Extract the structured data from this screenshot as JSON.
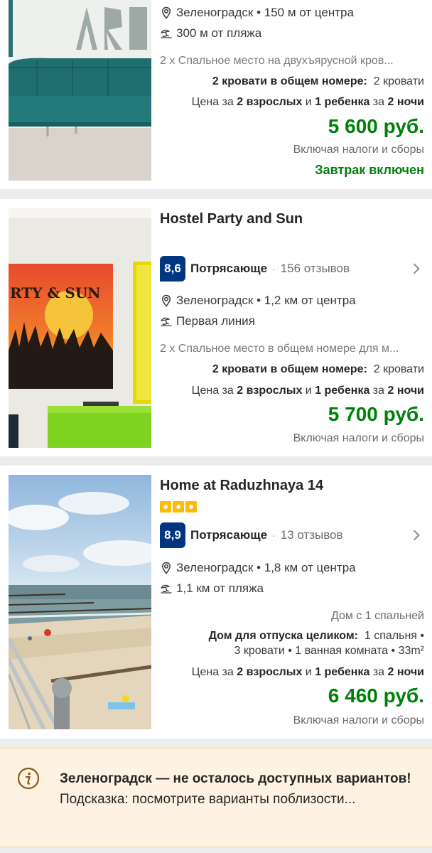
{
  "hotels": [
    {
      "location": "Зеленоградск • 150 м от центра",
      "beach": "300 м от пляжа",
      "room": "2 x Спальное место на двухъярусной кров...",
      "beds_label": "2 кровати в общем номере:",
      "beds_value": "2 кровати",
      "price_for": {
        "prefix": "Цена за",
        "adults": "2 взрослых",
        "and": "и",
        "child": "1 ребенка",
        "for": "за",
        "nights": "2 ночи"
      },
      "price": "5 600 руб.",
      "taxes": "Включая налоги и сборы",
      "breakfast": "Завтрак включен"
    },
    {
      "name": "Hostel Party and Sun",
      "score": "8,6",
      "rating_word": "Потрясающе",
      "reviews": "156 отзывов",
      "location": "Зеленоградск • 1,2 км от центра",
      "beach": "Первая линия",
      "room": "2 x Спальное место в общем номере для м...",
      "beds_label": "2 кровати в общем номере:",
      "beds_value": "2 кровати",
      "price_for": {
        "prefix": "Цена за",
        "adults": "2 взрослых",
        "and": "и",
        "child": "1 ребенка",
        "for": "за",
        "nights": "2 ночи"
      },
      "price": "5 700 руб.",
      "taxes": "Включая налоги и сборы",
      "photo_sign": "RTY & SUN"
    },
    {
      "name": "Home at Raduzhnaya 14",
      "stars": 3,
      "score": "8,9",
      "rating_word": "Потрясающе",
      "reviews": "13 отзывов",
      "location": "Зеленоградск • 1,8 км от центра",
      "beach": "1,1 км от пляжа",
      "house_type": "Дом с 1 спальней",
      "beds_label": "Дом для отпуска целиком:",
      "beds_value_1": "1 спальня •",
      "beds_value_2": "3 кровати • 1 ванная комната • 33m²",
      "price_for": {
        "prefix": "Цена за",
        "adults": "2 взрослых",
        "and": "и",
        "child": "1 ребенка",
        "for": "за",
        "nights": "2 ночи"
      },
      "price": "6 460 руб.",
      "taxes": "Включая налоги и сборы"
    }
  ],
  "notice": {
    "bold": "Зеленоградск — не осталось доступных вариантов!",
    "text": "Подсказка: посмотрите варианты поблизости..."
  },
  "icons": {
    "location": "map-pin-icon",
    "beach": "beach-umbrella-icon",
    "chevron": "chevron-right-icon",
    "info": "info-circle-icon"
  },
  "colors": {
    "price_green": "#008009",
    "score_blue": "#003580",
    "star_yellow": "#febb02",
    "notice_bg": "#fef3e2"
  }
}
